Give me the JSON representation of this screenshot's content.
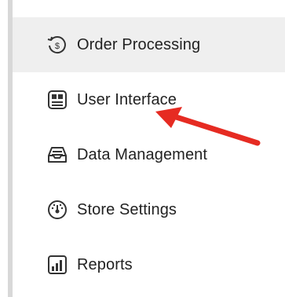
{
  "menu": {
    "items": [
      {
        "label": "Order Processing",
        "icon": "order-processing-icon",
        "active": true
      },
      {
        "label": "User Interface",
        "icon": "user-interface-icon",
        "active": false
      },
      {
        "label": "Data Management",
        "icon": "data-management-icon",
        "active": false
      },
      {
        "label": "Store Settings",
        "icon": "store-settings-icon",
        "active": false
      },
      {
        "label": "Reports",
        "icon": "reports-icon",
        "active": false
      }
    ]
  },
  "colors": {
    "active_background": "#efefef",
    "text": "#222222",
    "icon_stroke": "#333333",
    "annotation_arrow": "#e62b22",
    "left_border": "#d8d8d8"
  }
}
